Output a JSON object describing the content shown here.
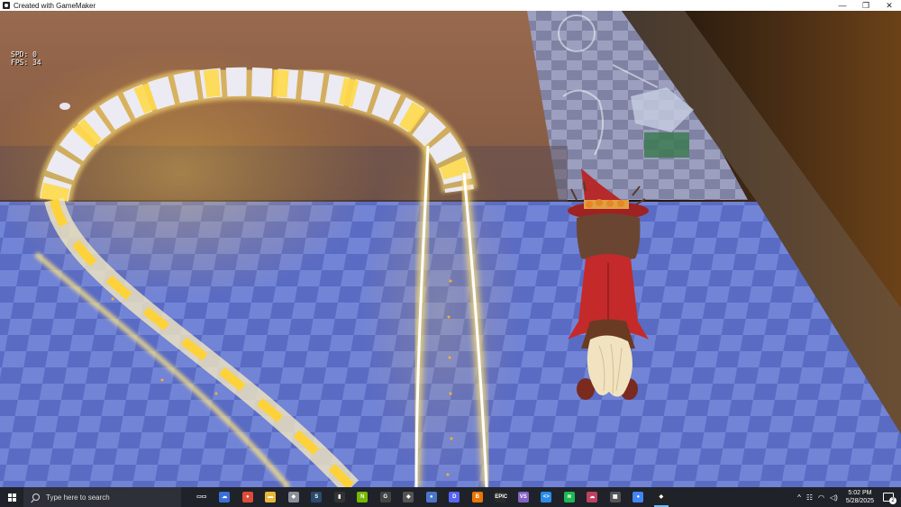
{
  "window": {
    "title": "Created with GameMaker",
    "controls": [
      "—",
      "❐",
      "✕"
    ]
  },
  "hud": {
    "spd": "SPD: 0",
    "fps": "FPS: 34"
  },
  "taskbar": {
    "search_placeholder": "Type here to search",
    "apps": [
      {
        "name": "task-view-icon",
        "glyph": "▭▭",
        "color": "#1f2228"
      },
      {
        "name": "widgets-icon",
        "glyph": "☁",
        "color": "#3a6fd8"
      },
      {
        "name": "chrome-icon",
        "glyph": "●",
        "color": "#dd4b39"
      },
      {
        "name": "file-explorer-icon",
        "glyph": "▬",
        "color": "#e8b83a"
      },
      {
        "name": "app-gray-icon",
        "glyph": "◆",
        "color": "#8a8f99"
      },
      {
        "name": "steam-icon",
        "glyph": "S",
        "color": "#2a4a6e"
      },
      {
        "name": "terminal-icon",
        "glyph": "▮",
        "color": "#333"
      },
      {
        "name": "nvidia-icon",
        "glyph": "N",
        "color": "#76b900"
      },
      {
        "name": "gamemaker-icon",
        "glyph": "G",
        "color": "#444"
      },
      {
        "name": "gamemaker-runner-icon",
        "glyph": "◆",
        "color": "#555"
      },
      {
        "name": "app-bear-icon",
        "glyph": "●",
        "color": "#4a76c8"
      },
      {
        "name": "discord-icon",
        "glyph": "D",
        "color": "#5865f2"
      },
      {
        "name": "blender-icon",
        "glyph": "B",
        "color": "#ea7600"
      },
      {
        "name": "epic-games-icon",
        "glyph": "EPIC",
        "color": "#2a2a2a"
      },
      {
        "name": "visual-studio-icon",
        "glyph": "VS",
        "color": "#8661c5"
      },
      {
        "name": "vscode-icon",
        "glyph": "<>",
        "color": "#2a8ce8"
      },
      {
        "name": "spotify-icon",
        "glyph": "≋",
        "color": "#1db954"
      },
      {
        "name": "app-cloud-icon",
        "glyph": "☁",
        "color": "#c04060"
      },
      {
        "name": "calculator-icon",
        "glyph": "▦",
        "color": "#555"
      },
      {
        "name": "chrome-alt-icon",
        "glyph": "●",
        "color": "#4285f4"
      },
      {
        "name": "gamemaker-active-icon",
        "glyph": "◆",
        "color": "#222"
      }
    ],
    "time": "5:02 PM",
    "date": "5/28/2025",
    "notifications_count": "2"
  }
}
